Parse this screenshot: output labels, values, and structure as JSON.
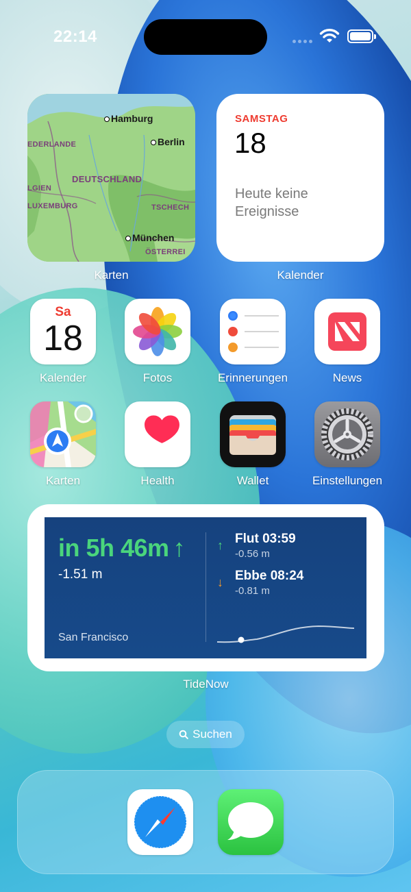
{
  "status": {
    "time": "22:14"
  },
  "widgets": {
    "map": {
      "caption": "Karten",
      "cities": [
        "Hamburg",
        "Berlin",
        "München"
      ],
      "countries": [
        "EDERLANDE",
        "DEUTSCHLAND",
        "LGIEN",
        "LUXEMBURG",
        "TSCHECH",
        "ÖSTERREI"
      ]
    },
    "calendar": {
      "caption": "Kalender",
      "weekday": "SAMSTAG",
      "date": "18",
      "events_text": "Heute keine Ereignisse"
    },
    "tide": {
      "caption": "TideNow",
      "countdown": "in 5h 46m",
      "countdown_arrow": "↑",
      "height": "-1.51 m",
      "location": "San Francisco",
      "high": {
        "label": "Flut 03:59",
        "value": "-0.56 m",
        "arrow": "↑"
      },
      "low": {
        "label": "Ebbe 08:24",
        "value": "-0.81 m",
        "arrow": "↓"
      }
    }
  },
  "apps": [
    {
      "label": "Kalender",
      "icon": "calendar-icon",
      "day": "Sa",
      "date": "18"
    },
    {
      "label": "Fotos",
      "icon": "photos-icon"
    },
    {
      "label": "Erinnerungen",
      "icon": "reminders-icon"
    },
    {
      "label": "News",
      "icon": "news-icon"
    },
    {
      "label": "Karten",
      "icon": "maps-icon"
    },
    {
      "label": "Health",
      "icon": "health-icon"
    },
    {
      "label": "Wallet",
      "icon": "wallet-icon"
    },
    {
      "label": "Einstellungen",
      "icon": "settings-icon"
    }
  ],
  "search": {
    "label": "Suchen"
  },
  "dock": [
    {
      "icon": "safari-icon"
    },
    {
      "icon": "messages-icon"
    }
  ],
  "colors": {
    "tide_green": "#4ad57c",
    "calendar_red": "#ee3b30",
    "tide_bg": "#174a8a"
  }
}
